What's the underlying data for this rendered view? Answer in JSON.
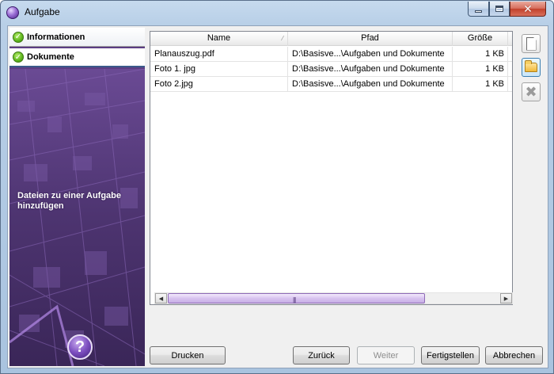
{
  "window": {
    "title": "Aufgabe"
  },
  "sidebar": {
    "items": [
      {
        "label": "Informationen"
      },
      {
        "label": "Dokumente"
      }
    ],
    "caption": "Dateien zu einer Aufgabe hinzufügen",
    "help_label": "?"
  },
  "table": {
    "columns": [
      "Name",
      "Pfad",
      "Größe"
    ],
    "rows": [
      {
        "name": "Planauszug.pdf",
        "path": "D:\\Basisve...\\Aufgaben und Dokumente",
        "size": "1 KB"
      },
      {
        "name": "Foto 1. jpg",
        "path": "D:\\Basisve...\\Aufgaben und Dokumente",
        "size": "1 KB"
      },
      {
        "name": "Foto 2.jpg",
        "path": "D:\\Basisve...\\Aufgaben und Dokumente",
        "size": "1 KB"
      }
    ]
  },
  "buttons": {
    "print": "Drucken",
    "back": "Zurück",
    "next": "Weiter",
    "finish": "Fertigstellen",
    "cancel": "Abbrechen"
  },
  "colors": {
    "accent": "#6b4aa0",
    "sidebar_bg": "#5b3d83"
  },
  "icons": {
    "window": "app-orb-icon",
    "new": "new-document-icon",
    "open": "open-folder-icon",
    "delete": "delete-icon"
  }
}
